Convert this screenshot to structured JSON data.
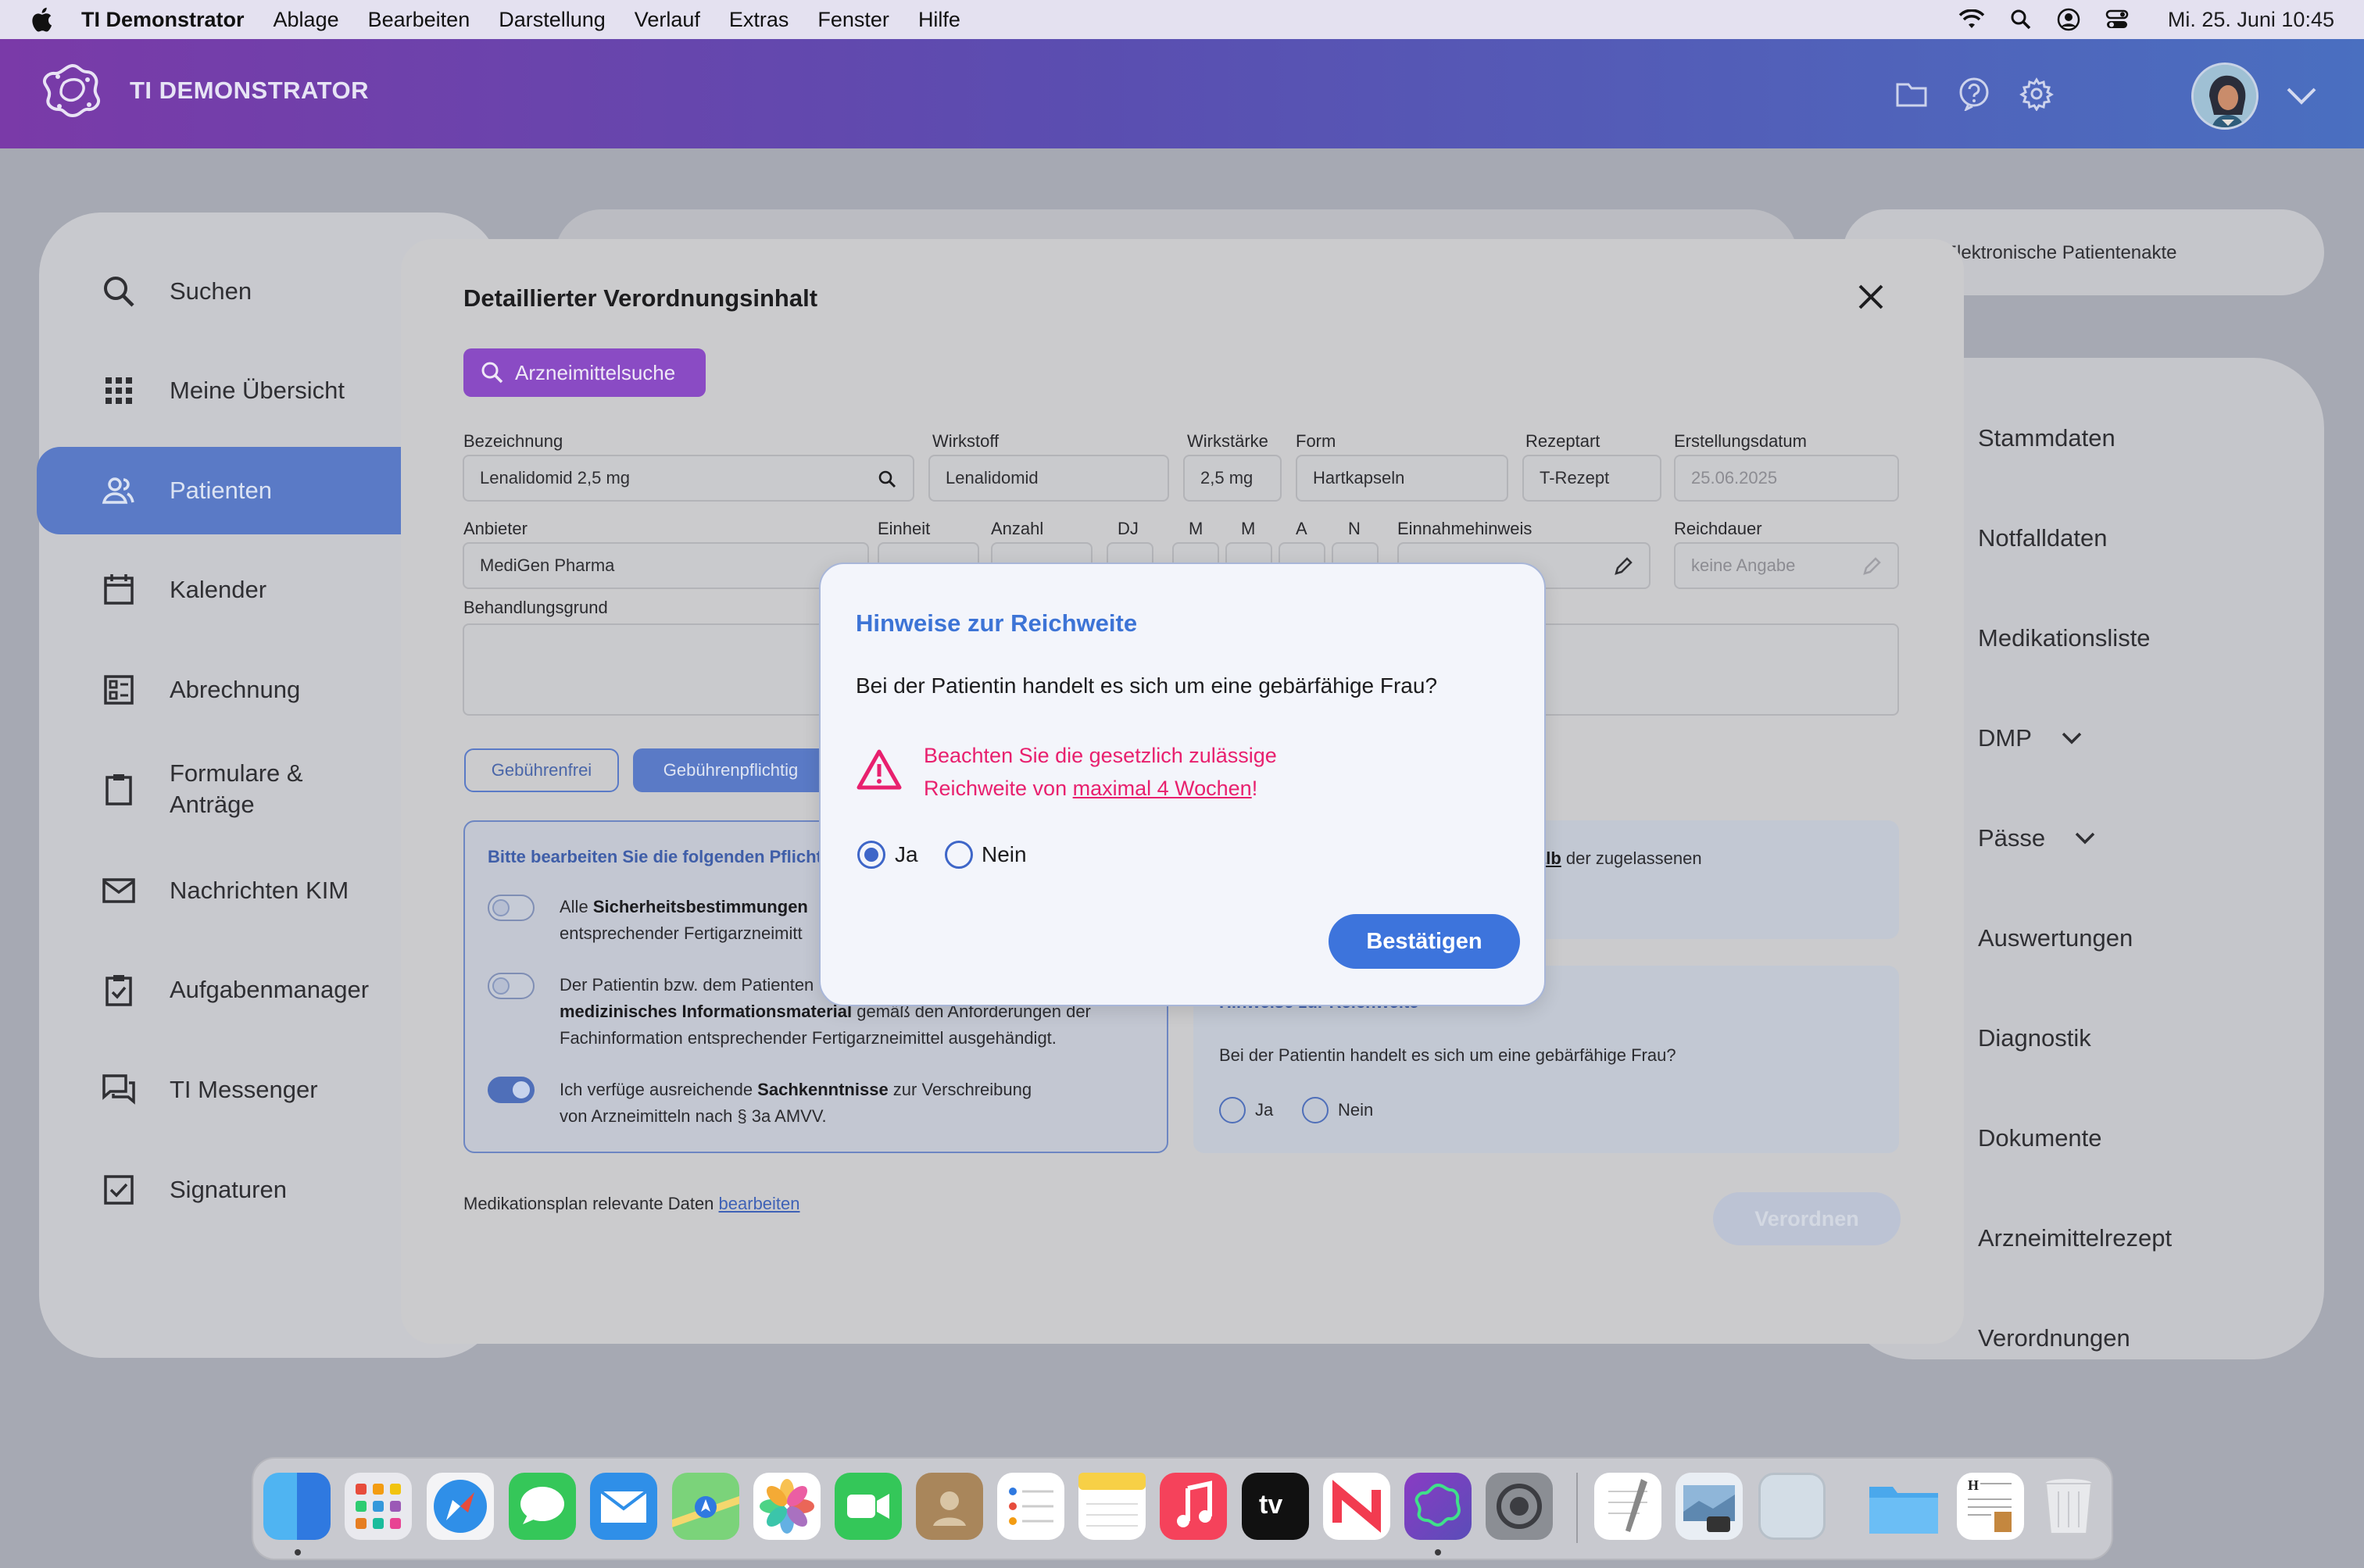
{
  "menubar": {
    "app_name": "TI Demonstrator",
    "menus": [
      "Ablage",
      "Bearbeiten",
      "Darstellung",
      "Verlauf",
      "Extras",
      "Fenster",
      "Hilfe"
    ],
    "clock": "Mi. 25. Juni 10:45"
  },
  "header": {
    "brand": "TI DEMONSTRATOR"
  },
  "left_nav": {
    "items": [
      {
        "label": "Suchen",
        "icon": "search-icon"
      },
      {
        "label": "Meine Übersicht",
        "icon": "grid-icon"
      },
      {
        "label": "Patienten",
        "icon": "users-icon",
        "active": true
      },
      {
        "label": "Kalender",
        "icon": "calendar-icon"
      },
      {
        "label": "Abrechnung",
        "icon": "billing-icon"
      },
      {
        "label_line1": "Formulare &",
        "label_line2": "Anträge",
        "icon": "clipboard-icon"
      },
      {
        "label": "Nachrichten KIM",
        "icon": "mail-icon"
      },
      {
        "label": "Aufgabenmanager",
        "icon": "task-icon"
      },
      {
        "label": "TI Messenger",
        "icon": "chat-icon"
      },
      {
        "label": "Signaturen",
        "icon": "checkbox-icon"
      }
    ]
  },
  "right_nav": {
    "top_card": "Elektronische Patientenakte",
    "items": [
      "Stammdaten",
      "Notfalldaten",
      "Medikationsliste",
      "DMP",
      "Pässe",
      "Auswertungen",
      "Diagnostik",
      "Dokumente",
      "Arzneimittelrezept",
      "Verordnungen"
    ]
  },
  "modal": {
    "title": "Detaillierter Verordnungsinhalt",
    "search_button": "Arzneimittelsuche",
    "labels": {
      "bezeichnung": "Bezeichnung",
      "wirkstoff": "Wirkstoff",
      "wirkstaerke": "Wirkstärke",
      "form": "Form",
      "rezeptart": "Rezeptart",
      "erstellungsdatum": "Erstellungsdatum",
      "anbieter": "Anbieter",
      "einheit": "Einheit",
      "anzahl": "Anzahl",
      "dj": "DJ",
      "m1": "M",
      "m2": "M",
      "a": "A",
      "n": "N",
      "einnahmehinweis": "Einnahmehinweis",
      "reichdauer": "Reichdauer",
      "behandlungsgrund": "Behandlungsgrund"
    },
    "values": {
      "bezeichnung": "Lenalidomid 2,5 mg",
      "wirkstoff": "Lenalidomid",
      "wirkstaerke": "2,5 mg",
      "form": "Hartkapseln",
      "rezeptart": "T-Rezept",
      "erstellungsdatum": "25.06.2025",
      "anbieter": "MediGen Pharma",
      "reichdauer_placeholder": "keine Angabe"
    },
    "buttons": {
      "gebuehrenfrei": "Gebührenfrei",
      "gebuehrenpflichtig": "Gebührenpflichtig",
      "verordnen": "Verordnen"
    },
    "pflicht_panel": {
      "title": "Bitte bearbeiten Sie die folgenden Pflicht",
      "item1_pre": "Alle ",
      "item1_bold": "Sicherheitsbestimmungen",
      "item1_line2": "entsprechender Fertigarzneimitt",
      "item2_line1": "Der Patientin bzw. dem Patienten",
      "item2_bold": "medizinisches Informationsmaterial",
      "item2_rest": " gemäß den Anforderungen der",
      "item2_line3": "Fachinformation entsprechender Fertigarzneimittel ausgehändigt.",
      "item3_pre": "Ich verfüge ausreichende ",
      "item3_bold": "Sachkenntnisse",
      "item3_rest": " zur Verschreibung",
      "item3_line2": "von Arzneimitteln nach § 3a AMVV.",
      "toggles": [
        false,
        false,
        true
      ]
    },
    "right_panel_top": {
      "text_bold": "alb",
      "text_rest": " der zugelassenen",
      "text_line2": ")"
    },
    "reichweite_panel": {
      "title": "Hinweise zur Reichweite",
      "question": "Bei der Patientin handelt es sich um eine gebärfähige Frau?",
      "ja": "Ja",
      "nein": "Nein"
    },
    "footer_text": "Medikationsplan relevante Daten ",
    "footer_link": "bearbeiten"
  },
  "dialog": {
    "title": "Hinweise zur Reichweite",
    "question": "Bei der Patientin handelt es sich um eine gebärfähige Frau?",
    "warning_line1": "Beachten Sie die gesetzlich zulässige",
    "warning_line2_pre": "Reichweite von ",
    "warning_link": "maximal 4 Wochen",
    "warning_line2_post": "!",
    "option_yes": "Ja",
    "option_no": "Nein",
    "selected": "Ja",
    "confirm": "Bestätigen"
  },
  "dock": {
    "apps": [
      "finder-icon",
      "launchpad-icon",
      "safari-icon",
      "messages-icon",
      "mail-icon",
      "maps-icon",
      "photos-icon",
      "facetime-icon",
      "contacts-icon",
      "reminders-icon",
      "notes-icon",
      "music-icon",
      "appletv-icon",
      "news-icon",
      "ti-demonstrator-icon",
      "system-settings-icon",
      "textedit-icon",
      "preview-icon",
      "blank-app-icon",
      "folder-icon",
      "document-icon",
      "trash-icon"
    ],
    "appletv_label": "tv"
  }
}
